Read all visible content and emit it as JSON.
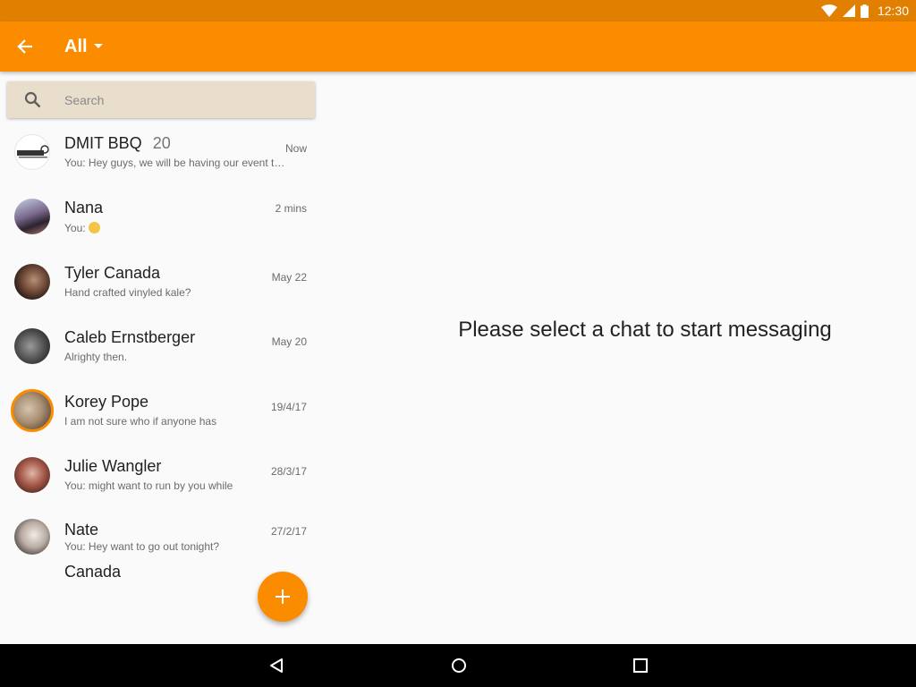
{
  "status_bar": {
    "time": "12:30",
    "icons": [
      "wifi-icon",
      "cell-signal-icon",
      "battery-icon"
    ]
  },
  "app_bar": {
    "back_icon": "arrow-left-icon",
    "filter_label": "All",
    "dropdown_icon": "caret-down-icon",
    "background": "#fb8c00"
  },
  "search": {
    "placeholder": "Search",
    "icon": "search-icon"
  },
  "chats": [
    {
      "name": "DMIT BBQ",
      "count": "20",
      "preview": "You: Hey guys, we will be having our event to...",
      "time": "Now"
    },
    {
      "name": "Nana",
      "count": "",
      "preview": "You: ",
      "has_emoji": true,
      "time": "2 mins"
    },
    {
      "name": "Tyler Canada",
      "count": "",
      "preview": "Hand crafted vinyled kale?",
      "time": "May 22"
    },
    {
      "name": "Caleb Ernstberger",
      "count": "",
      "preview": "Alrighty then.",
      "time": "May 20"
    },
    {
      "name": "Korey Pope",
      "count": "",
      "preview": "I am not sure who if anyone has",
      "time": "19/4/17"
    },
    {
      "name": "Julie Wangler",
      "count": "",
      "preview": "You: might want to run by you while",
      "time": "28/3/17"
    },
    {
      "name": "Nate",
      "count": "",
      "preview": "You: Hey want to go out tonight?",
      "time": "27/2/17"
    },
    {
      "name": "Canada",
      "count": "",
      "preview": "",
      "time": ""
    }
  ],
  "fab": {
    "icon": "plus-icon"
  },
  "main": {
    "empty_message": "Please select a chat to start messaging"
  },
  "nav_bar": {
    "back": "nav-back-icon",
    "home": "nav-home-icon",
    "recents": "nav-recents-icon"
  },
  "colors": {
    "accent": "#fb8c00",
    "status_bar": "#e07f00",
    "search_bg": "#e9ddcc"
  }
}
